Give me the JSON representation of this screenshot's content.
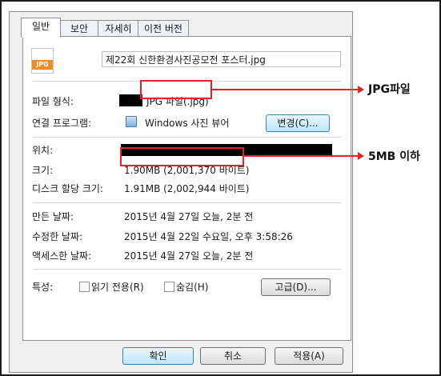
{
  "tabs": [
    "일반",
    "보안",
    "자세히",
    "이전 버전"
  ],
  "file": {
    "icon_text": "JPG",
    "name": "제22회 신한환경사진공모전 포스터.jpg"
  },
  "rows": {
    "type_label": "파일 형식:",
    "type_value": "JPG 파일(.jpg)",
    "open_label": "연결 프로그램:",
    "open_value": "Windows 사진 뷰어",
    "change_button": "변경(C)...",
    "location_label": "위치:",
    "size_label": "크기:",
    "size_value": "1.90MB (2,001,370 바이트)",
    "disk_label": "디스크 할당 크기:",
    "disk_value": "1.91MB (2,002,944 바이트)",
    "created_label": "만든 날짜:",
    "created_value": "2015년 4월 27일 오늘, 2분 전",
    "modified_label": "수정한 날짜:",
    "modified_value": "2015년 4월 22일 수요일, 오후 3:58:26",
    "accessed_label": "액세스한 날짜:",
    "accessed_value": "2015년 4월 27일 오늘, 2분 전",
    "attr_label": "특성:",
    "readonly_label": "읽기 전용(R)",
    "hidden_label": "숨김(H)",
    "advanced_button": "고급(D)..."
  },
  "buttons": {
    "ok": "확인",
    "cancel": "취소",
    "apply": "적용(A)"
  },
  "annotations": {
    "jpg": "JPG파일",
    "size": "5MB 이하"
  },
  "colors": {
    "annotation": "#e8202a",
    "redaction": "#000000"
  }
}
